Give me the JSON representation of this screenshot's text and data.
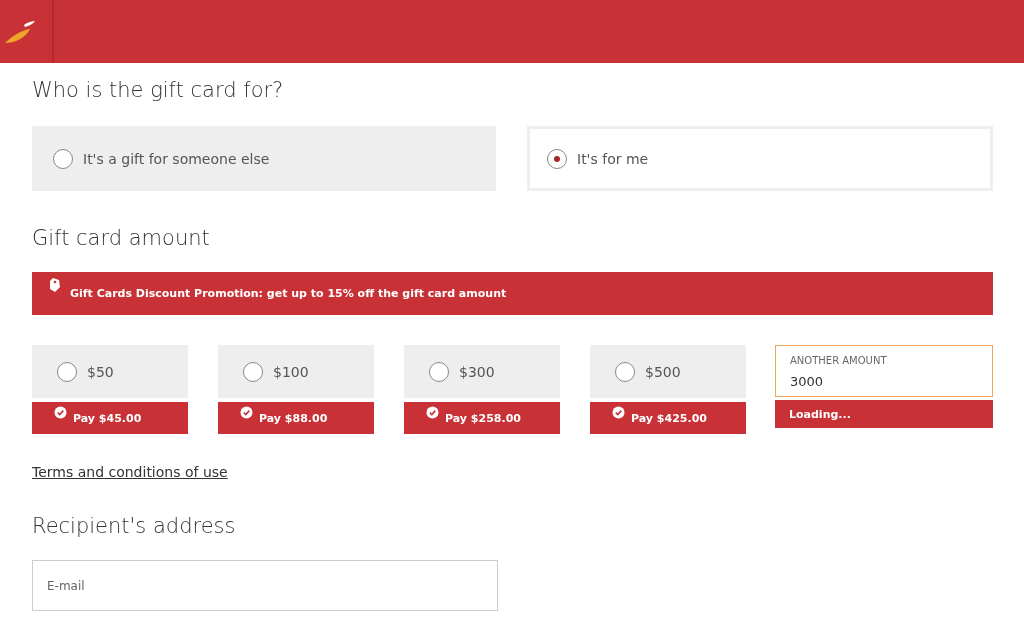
{
  "recipient": {
    "title": "Who is the gift card for?",
    "options": [
      {
        "label": "It's a gift for someone else",
        "selected": false
      },
      {
        "label": "It's for me",
        "selected": true
      }
    ]
  },
  "amount": {
    "title": "Gift card amount",
    "promotion": "Gift Cards Discount Promotion: get up to 15% off the gift card amount",
    "options": [
      {
        "label": "$50",
        "selected": false,
        "pay": "Pay $45.00"
      },
      {
        "label": "$100",
        "selected": false,
        "pay": "Pay $88.00"
      },
      {
        "label": "$300",
        "selected": false,
        "pay": "Pay $258.00"
      },
      {
        "label": "$500",
        "selected": false,
        "pay": "Pay $425.00"
      }
    ],
    "other": {
      "label": "ANOTHER AMOUNT",
      "value": "3000",
      "status": "Loading..."
    }
  },
  "terms_link": "Terms and conditions of use",
  "address": {
    "title": "Recipient's address",
    "email": {
      "placeholder": "E-mail"
    }
  }
}
